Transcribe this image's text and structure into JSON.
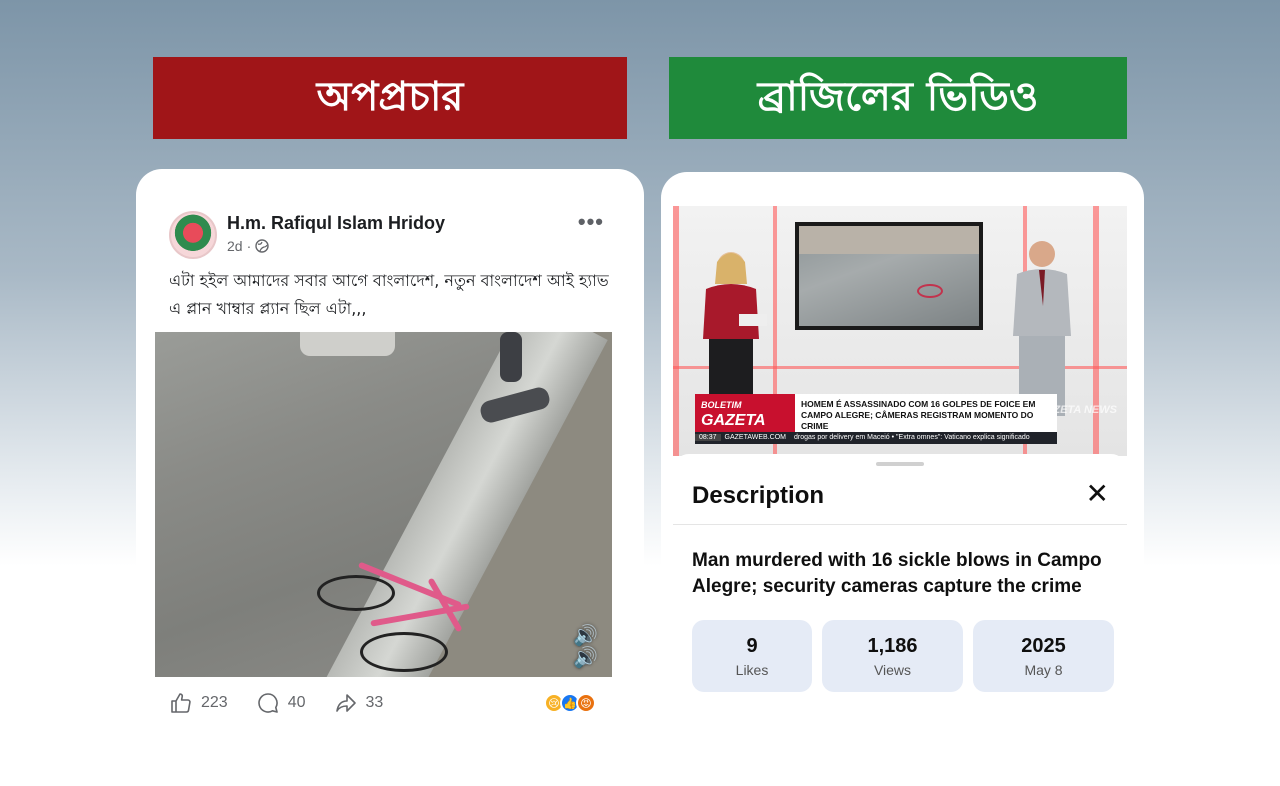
{
  "banners": {
    "left": "অপপ্রচার",
    "right": "ব্রাজিলের ভিডিও",
    "left_color": "#a01518",
    "right_color": "#1f8a3b"
  },
  "post": {
    "author": "H.m. Rafiqul Islam Hridoy",
    "time": "2d",
    "privacy_icon": "globe-icon",
    "more_icon": "•••",
    "text": "এটা হইল আমাদের সবার আগে বাংলাদেশ, নতুন বাংলাদেশ আই হ্যাভ এ প্লান খাম্বার প্ল্যান ছিল এটা,,,",
    "likes": "223",
    "comments": "40",
    "shares": "33",
    "reaction_icons": [
      "sad-icon",
      "like-icon",
      "angry-icon"
    ]
  },
  "video": {
    "lower_third_logo": "GAZETA",
    "lower_third_logo_top": "BOLETIM",
    "lower_third_headline": "HOMEM É ASSASSINADO COM 16 GOLPES DE FOICE EM CAMPO ALEGRE; CÂMERAS REGISTRAM MOMENTO DO CRIME",
    "ticker_time": "08:37",
    "ticker_site": "GAZETAWEB.COM",
    "ticker_text": "drogas por delivery em Maceió • \"Extra omnes\": Vaticano explica significado",
    "watermark": "GAZETA NEWS"
  },
  "description": {
    "header": "Description",
    "title": "Man murdered with 16 sickle blows in Campo Alegre; security cameras capture the crime",
    "stats": [
      {
        "value": "9",
        "label": "Likes"
      },
      {
        "value": "1,186",
        "label": "Views"
      },
      {
        "value": "2025",
        "label": "May 8"
      }
    ]
  }
}
